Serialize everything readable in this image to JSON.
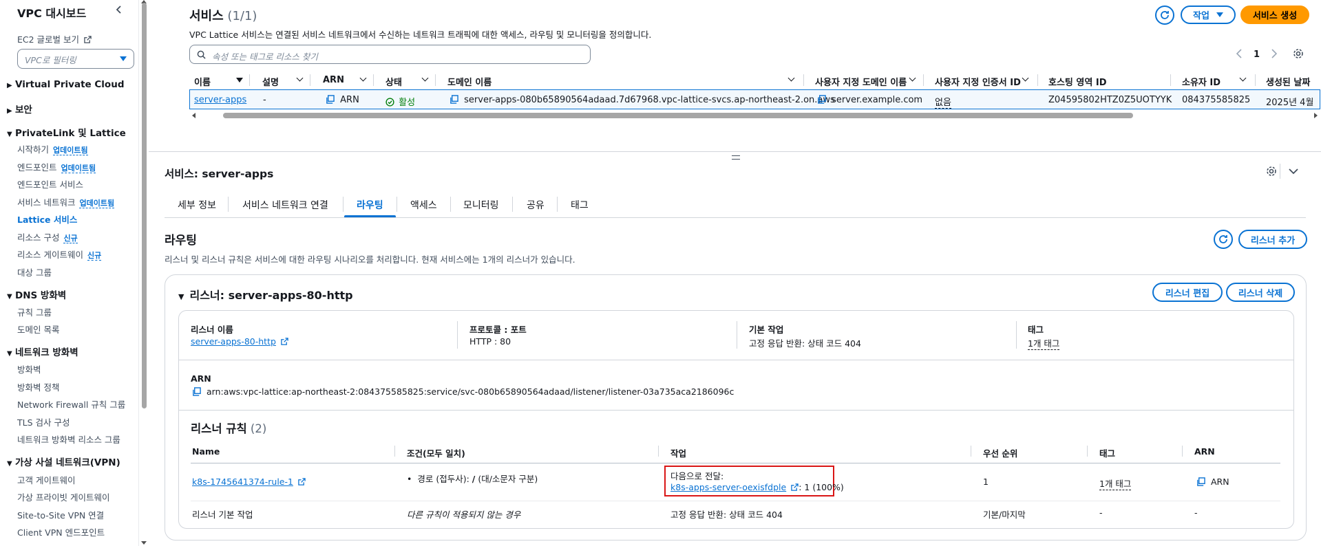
{
  "sidebar": {
    "title": "VPC 대시보드",
    "ec2_link": "EC2 글로벌 보기",
    "filter_placeholder": "VPC로 필터링",
    "sections": {
      "vpc": "Virtual Private Cloud",
      "security": "보안",
      "privatelink": "PrivateLink 및 Lattice",
      "dns": "DNS 방화벽",
      "netfw": "네트워크 방화벽",
      "vpn": "가상 사설 네트워크(VPN)"
    },
    "items": {
      "start": "시작하기",
      "endpoints": "엔드포인트",
      "endpoint_services": "엔드포인트 서비스",
      "service_networks": "서비스 네트워크",
      "lattice_services": "Lattice 서비스",
      "resource_configs": "리소스 구성",
      "resource_gateways": "리소스 게이트웨이",
      "target_groups": "대상 그룹",
      "rule_groups": "규칙 그룹",
      "domain_lists": "도메인 목록",
      "firewalls": "방화벽",
      "firewall_policies": "방화벽 정책",
      "nf_rule_groups": "Network Firewall 규칙 그룹",
      "tls_inspection": "TLS 검사 구성",
      "nf_resource_groups": "네트워크 방화벽 리소스 그룹",
      "customer_gateways": "고객 게이트웨이",
      "virtual_private_gateways": "가상 프라이빗 게이트웨이",
      "s2s_vpn": "Site-to-Site VPN 연결",
      "client_vpn": "Client VPN 엔드포인트"
    },
    "badges": {
      "updated": "업데이트됨",
      "new": "신규"
    }
  },
  "services": {
    "title": "서비스",
    "count": "(1/1)",
    "description": "VPC Lattice 서비스는 연결된 서비스 네트워크에서 수신하는 네트워크 트래픽에 대한 액세스, 라우팅 및 모니터링을 정의합니다.",
    "search_placeholder": "속성 또는 태그로 리소스 찾기",
    "actions_label": "작업",
    "create_label": "서비스 생성",
    "page": "1",
    "columns": {
      "name": "이름",
      "desc": "설명",
      "arn": "ARN",
      "status": "상태",
      "domain": "도메인 이름",
      "custom_domain": "사용자 지정 도메인 이름",
      "cert": "사용자 지정 인증서 ID",
      "zone": "호스팅 영역 ID",
      "owner": "소유자 ID",
      "created": "생성된 날짜"
    },
    "row": {
      "name": "server-apps",
      "desc": "-",
      "arn": "ARN",
      "status": "활성",
      "domain": "server-apps-080b65890564adaad.7d67968.vpc-lattice-svcs.ap-northeast-2.on.aws",
      "custom_domain": "server.example.com",
      "cert": "없음",
      "zone": "Z04595802HTZ0Z5UOTYYK",
      "owner": "084375585825",
      "created": "2025년 4월"
    }
  },
  "detail": {
    "title": "서비스: server-apps",
    "tabs": [
      "세부 정보",
      "서비스 네트워크 연결",
      "라우팅",
      "액세스",
      "모니터링",
      "공유",
      "태그"
    ],
    "routing": {
      "title": "라우팅",
      "description": "리스너 및 리스너 규칙은 서비스에 대한 라우팅 시나리오를 처리합니다. 현재 서비스에는 1개의 리스너가 있습니다.",
      "add_listener": "리스너 추가"
    },
    "listener": {
      "title": "리스너: server-apps-80-http",
      "edit": "리스너 편집",
      "delete": "리스너 삭제",
      "name_label": "리스너 이름",
      "name_value": "server-apps-80-http",
      "protocol_label": "프로토콜 : 포트",
      "protocol_value": "HTTP : 80",
      "default_label": "기본 작업",
      "default_value": "고정 응답 반환: 상태 코드 404",
      "tags_label": "태그",
      "tags_value": "1개 태그",
      "arn_label": "ARN",
      "arn_value": "arn:aws:vpc-lattice:ap-northeast-2:084375585825:service/svc-080b65890564adaad/listener/listener-03a735aca2186096c"
    },
    "rules": {
      "title": "리스너 규칙",
      "count": "(2)",
      "columns": {
        "name": "Name",
        "condition": "조건(모두 일치)",
        "action": "작업",
        "priority": "우선 순위",
        "tags": "태그",
        "arn": "ARN"
      },
      "row1": {
        "name": "k8s-1745641374-rule-1",
        "condition_prefix": "경로 (접두사): ",
        "condition_path": "/",
        "condition_suffix": " (대/소문자 구분)",
        "action_label": "다음으로 전달:",
        "action_target": "k8s-apps-server-oexisfdple",
        "action_weight": ": 1 (100%)",
        "priority": "1",
        "tags": "1개 태그",
        "arn": "ARN"
      },
      "row2": {
        "name": "리스너 기본 작업",
        "condition": "다른 규칙이 적용되지 않는 경우",
        "action": "고정 응답 반환: 상태 코드 404",
        "priority": "기본/마지막",
        "tags": "-",
        "arn": "-"
      }
    }
  },
  "colors": {
    "accent": "#0972d3",
    "primary_button": "#ff9900",
    "success": "#037f0c",
    "highlight": "#d91515"
  }
}
